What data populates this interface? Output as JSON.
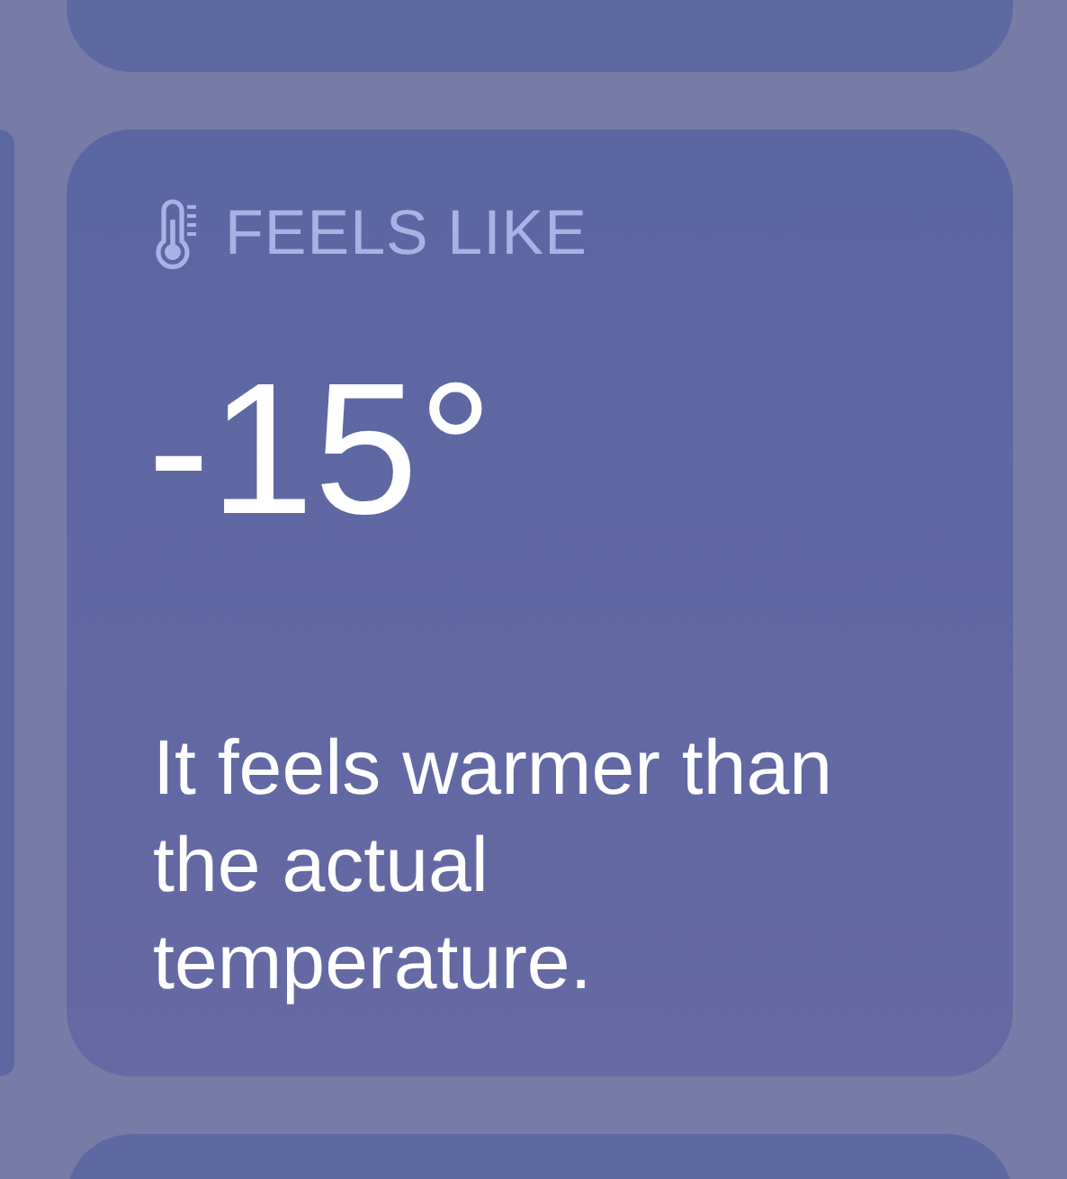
{
  "widget": {
    "title": "FEELS LIKE",
    "value": "-15°",
    "description": "It feels warmer than the actual temperature."
  }
}
